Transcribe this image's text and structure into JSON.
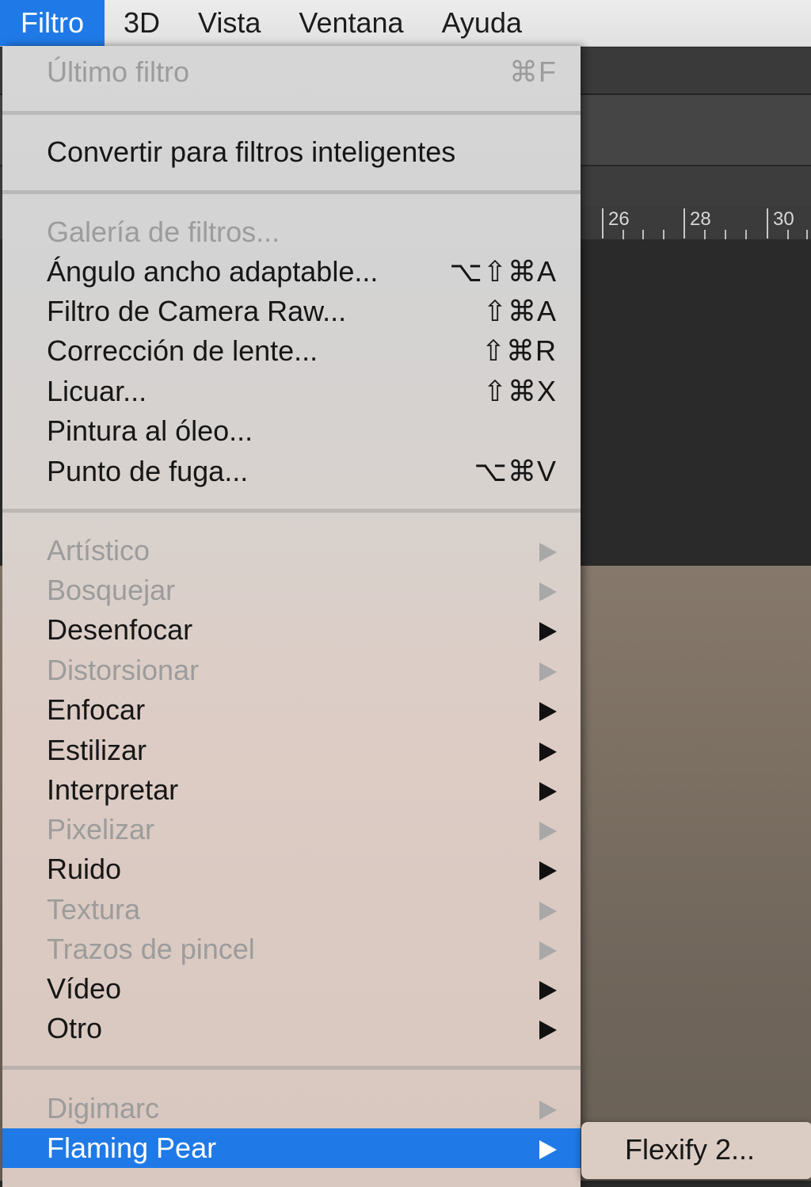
{
  "menubar": {
    "items": [
      {
        "label": "Filtro",
        "active": true
      },
      {
        "label": "3D"
      },
      {
        "label": "Vista"
      },
      {
        "label": "Ventana"
      },
      {
        "label": "Ayuda"
      }
    ]
  },
  "ruler": {
    "ticks": [
      "26",
      "28",
      "30"
    ]
  },
  "menu": {
    "last_filter": {
      "label": "Último filtro",
      "shortcut": "⌘F"
    },
    "convert_smart": {
      "label": "Convertir para filtros inteligentes"
    },
    "filter_gallery": {
      "label": "Galería de filtros..."
    },
    "adaptive_wide_angle": {
      "label": "Ángulo ancho adaptable...",
      "shortcut": "⌥⇧⌘A"
    },
    "camera_raw": {
      "label": "Filtro de Camera Raw...",
      "shortcut": "⇧⌘A"
    },
    "lens_correction": {
      "label": "Corrección de lente...",
      "shortcut": "⇧⌘R"
    },
    "liquify": {
      "label": "Licuar...",
      "shortcut": "⇧⌘X"
    },
    "oil_paint": {
      "label": "Pintura al óleo..."
    },
    "vanishing_point": {
      "label": "Punto de fuga...",
      "shortcut": "⌥⌘V"
    },
    "artistic": {
      "label": "Artístico"
    },
    "sketch": {
      "label": "Bosquejar"
    },
    "blur": {
      "label": "Desenfocar"
    },
    "distort": {
      "label": "Distorsionar"
    },
    "sharpen": {
      "label": "Enfocar"
    },
    "stylize": {
      "label": "Estilizar"
    },
    "render": {
      "label": "Interpretar"
    },
    "pixelate": {
      "label": "Pixelizar"
    },
    "noise": {
      "label": "Ruido"
    },
    "texture": {
      "label": "Textura"
    },
    "brush_strokes": {
      "label": "Trazos de pincel"
    },
    "video": {
      "label": "Vídeo"
    },
    "other": {
      "label": "Otro"
    },
    "digimarc": {
      "label": "Digimarc"
    },
    "flaming_pear": {
      "label": "Flaming Pear"
    }
  },
  "submenu": {
    "flexify": {
      "label": "Flexify 2..."
    }
  },
  "colors": {
    "highlight": "#1f7ae7",
    "disabled_text": "#9c9c9c"
  }
}
